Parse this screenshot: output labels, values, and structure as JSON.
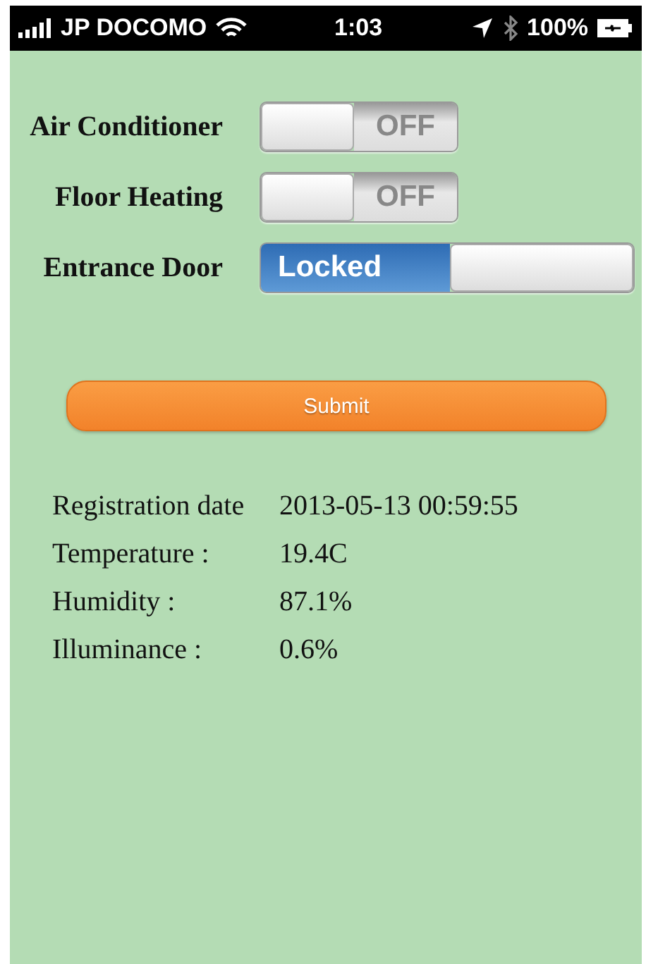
{
  "status_bar": {
    "carrier": "JP DOCOMO",
    "time": "1:03",
    "battery": "100%"
  },
  "switches": [
    {
      "label": "Air Conditioner",
      "state_text": "OFF",
      "on": false
    },
    {
      "label": "Floor Heating",
      "state_text": "OFF",
      "on": false
    },
    {
      "label": "Entrance Door",
      "state_text": "Locked",
      "on": true
    }
  ],
  "submit": {
    "label": "Submit"
  },
  "readings": [
    {
      "label": "Registration date",
      "value": "2013-05-13 00:59:55"
    },
    {
      "label": "Temperature :",
      "value": "19.4C"
    },
    {
      "label": "Humidity :",
      "value": "87.1%"
    },
    {
      "label": "Illuminance :",
      "value": "0.6%"
    }
  ]
}
